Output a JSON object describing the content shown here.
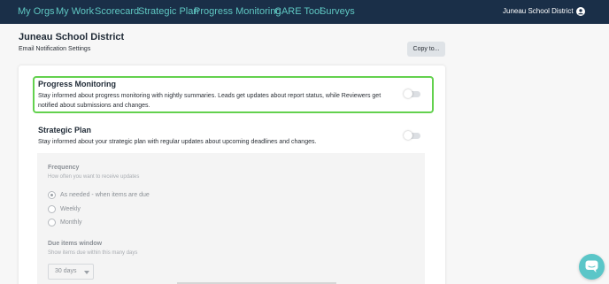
{
  "nav": {
    "items": [
      {
        "label": "My Orgs"
      },
      {
        "label": "My Work"
      },
      {
        "label": "Scorecard"
      },
      {
        "label": "Strategic Plan"
      },
      {
        "label": "Progress Monitoring"
      },
      {
        "label": "CARE Tool"
      },
      {
        "label": "Surveys"
      }
    ],
    "district": "Juneau School District",
    "user_icon": "user-circle-icon"
  },
  "header": {
    "title": "Juneau School District",
    "subtitle": "Email Notification Settings",
    "copy_label": "Copy to..."
  },
  "sections": [
    {
      "title": "Progress Monitoring",
      "description": "Stay informed about progress monitoring with nightly summaries. Leads get updates about report status, while Reviewers get notified about submissions and changes.",
      "enabled": false
    },
    {
      "title": "Strategic Plan",
      "description": "Stay informed about your strategic plan with regular updates about upcoming deadlines and changes.",
      "enabled": false
    }
  ],
  "settings": {
    "frequency_label": "Frequency",
    "frequency_help": "How often you want to receive updates",
    "options": [
      {
        "label": "As needed - when items are due",
        "checked": true
      },
      {
        "label": "Weekly",
        "checked": false
      },
      {
        "label": "Monthly",
        "checked": false
      }
    ],
    "due_label": "Due items window",
    "due_help": "Show items due within this many days",
    "due_value": "30 days"
  },
  "colors": {
    "nav_bg": "#1a2f48",
    "nav_link": "#5fc7c2",
    "highlight": "#63d14e",
    "chat": "#5bc6c8"
  },
  "chat_icon": "chat-bubble-icon"
}
